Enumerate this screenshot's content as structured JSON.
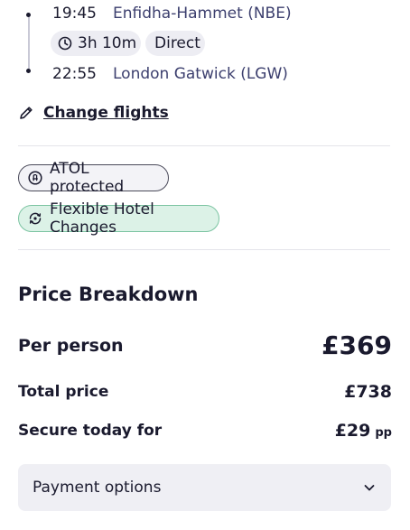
{
  "flight": {
    "departure_time": "19:45",
    "departure_airport": "Enfidha-Hammet (NBE)",
    "duration": "3h 10m",
    "stops": "Direct",
    "arrival_time": "22:55",
    "arrival_airport": "London Gatwick (LGW)",
    "change_label": "Change flights"
  },
  "badges": {
    "atol": "ATOL protected",
    "flexible": "Flexible Hotel Changes"
  },
  "price": {
    "heading": "Price Breakdown",
    "per_person_label": "Per person",
    "per_person_value": "£369",
    "total_label": "Total price",
    "total_value": "£738",
    "secure_label": "Secure today for",
    "secure_value": "£29",
    "secure_suffix": "pp"
  },
  "payment": {
    "label": "Payment options"
  },
  "icons": {
    "clock": "clock-icon",
    "pencil": "pencil-icon",
    "atol": "atol-shield-icon",
    "flex": "flexible-change-icon",
    "chevron": "chevron-down-icon"
  },
  "colors": {
    "text": "#1a1a2e",
    "airport_text": "#3c3f6e",
    "flex_badge_bg": "#dcf2e7",
    "flex_badge_border": "#7cc4a2"
  }
}
